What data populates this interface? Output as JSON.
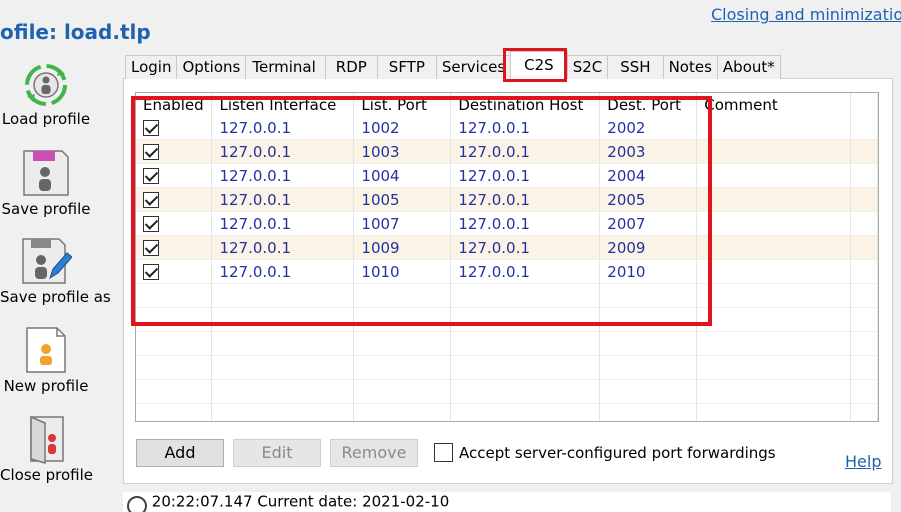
{
  "header": {
    "title": "ofile: load.tlp",
    "top_link": "Closing and minimization"
  },
  "sidebar": {
    "items": [
      {
        "label": "Load profile",
        "icon": "load-profile-icon"
      },
      {
        "label": "Save profile",
        "icon": "save-profile-icon"
      },
      {
        "label": "Save profile as",
        "icon": "save-profile-as-icon"
      },
      {
        "label": "New profile",
        "icon": "new-profile-icon"
      },
      {
        "label": "Close profile",
        "icon": "close-profile-icon"
      }
    ]
  },
  "tabs": [
    {
      "label": "Login"
    },
    {
      "label": "Options"
    },
    {
      "label": "Terminal"
    },
    {
      "label": "RDP"
    },
    {
      "label": "SFTP"
    },
    {
      "label": "Services"
    },
    {
      "label": "C2S",
      "active": true
    },
    {
      "label": "S2C"
    },
    {
      "label": "SSH"
    },
    {
      "label": "Notes"
    },
    {
      "label": "About*"
    }
  ],
  "table": {
    "columns": [
      "Enabled",
      "Listen Interface",
      "List. Port",
      "Destination Host",
      "Dest. Port",
      "Comment"
    ],
    "rows": [
      {
        "enabled": true,
        "listen": "127.0.0.1",
        "port": "1002",
        "dest": "127.0.0.1",
        "dport": "2002",
        "comment": ""
      },
      {
        "enabled": true,
        "listen": "127.0.0.1",
        "port": "1003",
        "dest": "127.0.0.1",
        "dport": "2003",
        "comment": ""
      },
      {
        "enabled": true,
        "listen": "127.0.0.1",
        "port": "1004",
        "dest": "127.0.0.1",
        "dport": "2004",
        "comment": ""
      },
      {
        "enabled": true,
        "listen": "127.0.0.1",
        "port": "1005",
        "dest": "127.0.0.1",
        "dport": "2005",
        "comment": ""
      },
      {
        "enabled": true,
        "listen": "127.0.0.1",
        "port": "1007",
        "dest": "127.0.0.1",
        "dport": "2007",
        "comment": ""
      },
      {
        "enabled": true,
        "listen": "127.0.0.1",
        "port": "1009",
        "dest": "127.0.0.1",
        "dport": "2009",
        "comment": ""
      },
      {
        "enabled": true,
        "listen": "127.0.0.1",
        "port": "1010",
        "dest": "127.0.0.1",
        "dport": "2010",
        "comment": ""
      }
    ]
  },
  "buttons": {
    "add": "Add",
    "edit": "Edit",
    "remove": "Remove"
  },
  "accept_label": "Accept server-configured port forwardings",
  "help_label": "Help",
  "status_text": "20:22:07.147  Current date: 2021-02-10",
  "colors": {
    "accent": "#1f63b0",
    "highlight": "#e0141e",
    "cell_text": "#2230a0",
    "alt_row": "#fbf4e6"
  }
}
